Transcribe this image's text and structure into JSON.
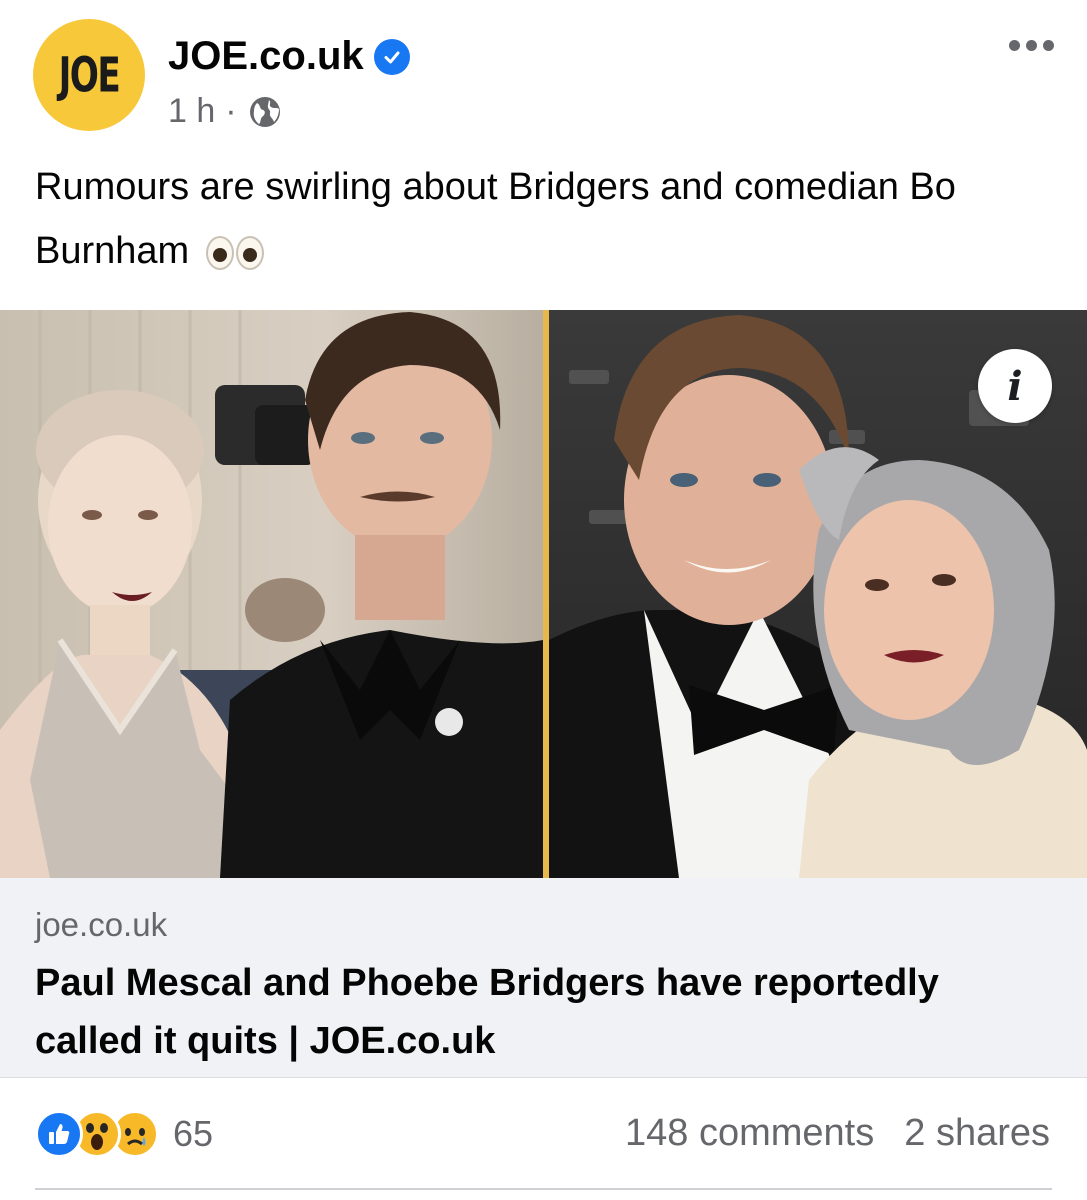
{
  "header": {
    "avatar_text": "JOE",
    "page_name": "JOE.co.uk",
    "time": "1 h",
    "separator": "·",
    "icons": [
      "verified-icon",
      "globe-icon",
      "more-icon"
    ]
  },
  "post": {
    "text": "Rumours are swirling about Bridgers and comedian Bo Burnham",
    "emoji": "eyes-icon"
  },
  "link": {
    "domain": "joe.co.uk",
    "title": "Paul Mescal and Phoebe Bridgers have reportedly called it quits | JOE.co.uk",
    "info_icon_text": "i"
  },
  "footer": {
    "reaction_icons": [
      "like-icon",
      "wow-icon",
      "sad-icon"
    ],
    "reaction_count": "65",
    "comments": "148 comments",
    "shares": "2 shares"
  },
  "colors": {
    "brand_yellow": "#f7c93a",
    "facebook_blue": "#1877f2",
    "secondary_text": "#65676b",
    "link_box_bg": "#f0f2f5",
    "divider_gold": "#e8b84a"
  }
}
